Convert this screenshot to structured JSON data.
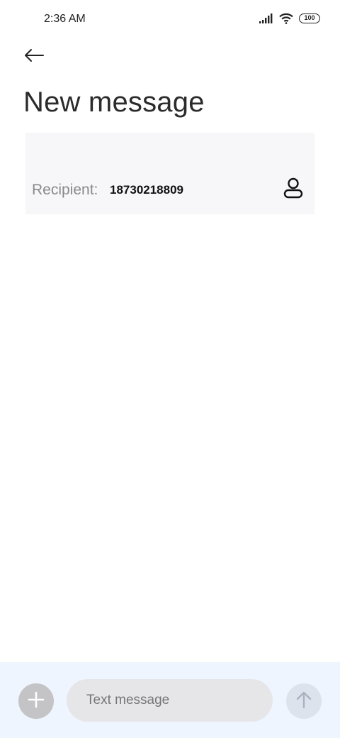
{
  "status_bar": {
    "time": "2:36 AM",
    "battery_level": "100",
    "icons": [
      "signal-icon",
      "wifi-icon",
      "battery-icon"
    ]
  },
  "header": {
    "back_icon": "arrow-left-icon",
    "title": "New message"
  },
  "recipient": {
    "label": "Recipient:",
    "value": "18730218809",
    "contact_icon": "person-icon"
  },
  "compose": {
    "add_icon": "plus-icon",
    "input_placeholder": "Text message",
    "input_value": "",
    "send_icon": "arrow-up-icon"
  },
  "colors": {
    "recipient_panel_bg": "#f7f6f8",
    "compose_bar_bg": "#eef5fe",
    "add_button_bg": "#c4c4c6",
    "send_button_bg": "#dde3ec"
  }
}
